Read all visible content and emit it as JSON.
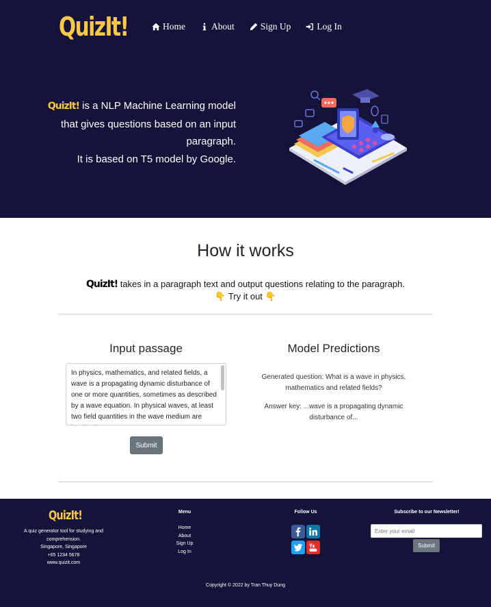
{
  "header": {
    "brand": "QuizIt!",
    "nav": [
      {
        "label": "Home",
        "icon": "home-icon"
      },
      {
        "label": "About",
        "icon": "info-icon"
      },
      {
        "label": "Sign Up",
        "icon": "pencil-icon"
      },
      {
        "label": "Log In",
        "icon": "sign-in-icon"
      }
    ]
  },
  "hero": {
    "brand": "QuizIt!",
    "line1": "is a NLP Machine Learning model",
    "line2": "that gives questions based on an input",
    "line3": "paragraph.",
    "line4": "It is based on T5 model by Google."
  },
  "how": {
    "title": "How it works",
    "brand": "QuizIt!",
    "desc": "takes in a paragraph text and output questions relating to the paragraph.",
    "try_text": "Try it out",
    "emoji": "👇"
  },
  "input": {
    "title": "Input passage",
    "passage": "In physics, mathematics, and related fields, a wave is a propagating dynamic disturbance of one or more quantities, sometimes as described by a wave equation. In physical waves, at least two field quantities in the wave medium are involved.",
    "submit_label": "Submit"
  },
  "predictions": {
    "title": "Model Predictions",
    "question": "Generated question: What is a wave in physics, mathematics and related fields?",
    "answer": "Answer key: ...wave is a propagating dynamic disturbance of..."
  },
  "footer": {
    "brand": "QuizIt!",
    "about_line1": "A quiz generator tool for studying and comprehension.",
    "location": "Singapore, Singapore",
    "phone": "+65 1234 5678",
    "website": "www.quizit.com",
    "menu_title": "Menu",
    "menu": [
      "Home",
      "About",
      "Sign Up",
      "Log In"
    ],
    "follow_title": "Follow Us",
    "newsletter_title": "Subscribe to our Newsletter!",
    "email_placeholder": "Enter your email",
    "submit_label": "Submit",
    "copyright": "Copyright © 2022 by Tran Thuy Dung"
  },
  "colors": {
    "navy": "#16133a",
    "brand_yellow": "#f9c846",
    "button_gray": "#6c757d",
    "facebook": "#3b5998",
    "linkedin": "#0e76a8",
    "twitter": "#1da1f2",
    "youtube": "#e52d27"
  }
}
